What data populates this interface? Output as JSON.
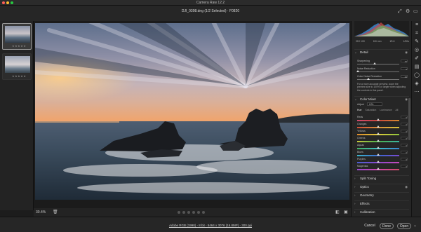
{
  "window": {
    "title": "Camera Raw 12.2",
    "colors": {
      "close": "#fc5f57",
      "minimize": "#fdbc2e",
      "zoom": "#28c840"
    }
  },
  "header": {
    "file_info": "DJI_0398.dng (1/2 Selected)  ·  F0820",
    "icons": [
      "fullscreen-icon",
      "gear-icon",
      "open-object-icon"
    ]
  },
  "filmstrip": {
    "items": [
      {
        "stars": "★★★★★",
        "selected": true
      },
      {
        "stars": "★★★★★",
        "selected": false
      }
    ]
  },
  "canvas": {
    "zoom": "30.4%",
    "pager_dots": 6
  },
  "panel": {
    "exif": [
      "ISO 100",
      "8.8 mm",
      "f/5.6",
      "1/50s"
    ],
    "detail": {
      "heading": "Detail",
      "sliders": [
        {
          "label": "Sharpening",
          "value": "40",
          "position": 0.4
        },
        {
          "label": "Noise Reduction",
          "value": "0",
          "position": 0.0
        },
        {
          "label": "Color Noise Reduction",
          "value": "25",
          "position": 0.25
        }
      ],
      "note": "For a more accurate preview, zoom the preview size to 100% or larger when adjusting the controls in this panel."
    },
    "color_mixer": {
      "heading": "Color Mixer",
      "adjust_label": "Adjust",
      "adjust_value": "HSL",
      "tabs": [
        "Hue",
        "Saturation",
        "Luminance",
        "All"
      ],
      "rows": [
        {
          "label": "Reds",
          "value": "0",
          "colors": [
            "#d04a6e",
            "#c9453d",
            "#d88a2d"
          ]
        },
        {
          "label": "Oranges",
          "value": "0",
          "colors": [
            "#cf4f35",
            "#d8913a",
            "#d8c23c"
          ]
        },
        {
          "label": "Yellows",
          "value": "0",
          "colors": [
            "#dc8a2c",
            "#dccb3a",
            "#8fc43c"
          ]
        },
        {
          "label": "Greens",
          "value": "0",
          "colors": [
            "#c8c83c",
            "#4cb14d",
            "#3ab5a0"
          ]
        },
        {
          "label": "Aquas",
          "value": "0",
          "colors": [
            "#44b061",
            "#3cbcc8",
            "#3a86cf"
          ]
        },
        {
          "label": "Blues",
          "value": "0",
          "colors": [
            "#3cb5c9",
            "#3a67d0",
            "#7a4bcf"
          ]
        },
        {
          "label": "Purples",
          "value": "0",
          "colors": [
            "#4a5fd0",
            "#8b47cf",
            "#c84bb9"
          ]
        },
        {
          "label": "Magentas",
          "value": "0",
          "colors": [
            "#9a48cf",
            "#cc48a9",
            "#d04a66"
          ]
        }
      ]
    },
    "collapsed_sections": [
      "Split Toning",
      "Optics",
      "Geometry",
      "Effects",
      "Calibration"
    ]
  },
  "footer": {
    "workflow": "Adobe RGB (1998) - 8 bit - 5464 x 3076 (16.8MP) - 300 ppi",
    "cancel": "Cancel",
    "done": "Done",
    "open": "Open"
  }
}
